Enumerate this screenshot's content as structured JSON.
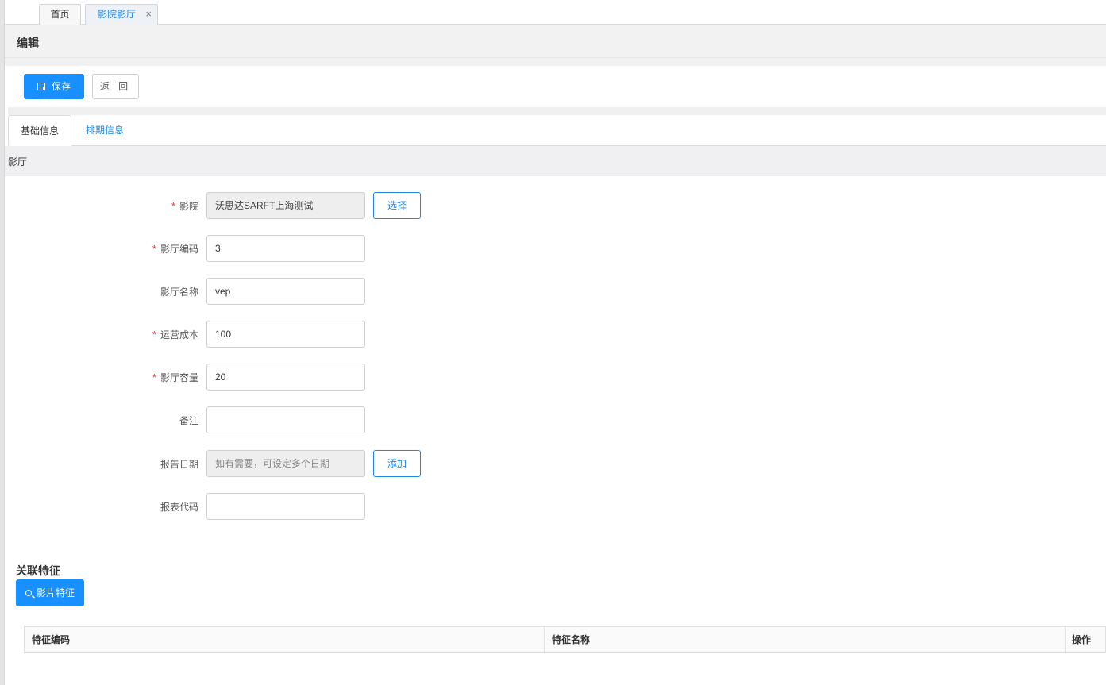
{
  "tabs": {
    "home": "首页",
    "active": "影院影厅",
    "close_glyph": "×"
  },
  "page": {
    "title": "编辑"
  },
  "toolbar": {
    "save": "保存",
    "back": "返 回"
  },
  "inner_tabs": {
    "basic": "基础信息",
    "schedule": "排期信息"
  },
  "section": {
    "title": "影厅"
  },
  "form": {
    "cinema": {
      "label": "影院",
      "value": "沃思达SARFT上海测试",
      "button": "选择",
      "required": true
    },
    "hall_code": {
      "label": "影厅编码",
      "value": "3",
      "required": true
    },
    "hall_name": {
      "label": "影厅名称",
      "value": "vep",
      "required": false
    },
    "op_cost": {
      "label": "运营成本",
      "value": "100",
      "required": true
    },
    "capacity": {
      "label": "影厅容量",
      "value": "20",
      "required": true
    },
    "remark": {
      "label": "备注",
      "value": "",
      "required": false
    },
    "report_date": {
      "label": "报告日期",
      "placeholder": "如有需要，可设定多个日期",
      "button": "添加",
      "required": false
    },
    "report_code": {
      "label": "报表代码",
      "value": "",
      "required": false
    },
    "required_mark": "*"
  },
  "related": {
    "title": "关联特征",
    "button": "影片特征",
    "columns": [
      "特征编码",
      "特征名称",
      "操作"
    ]
  },
  "colors": {
    "primary": "#1890ff",
    "link": "#1e88e5",
    "required": "#e53935"
  },
  "icons": {
    "save": "save-icon",
    "search": "search-icon",
    "close": "close-icon"
  }
}
